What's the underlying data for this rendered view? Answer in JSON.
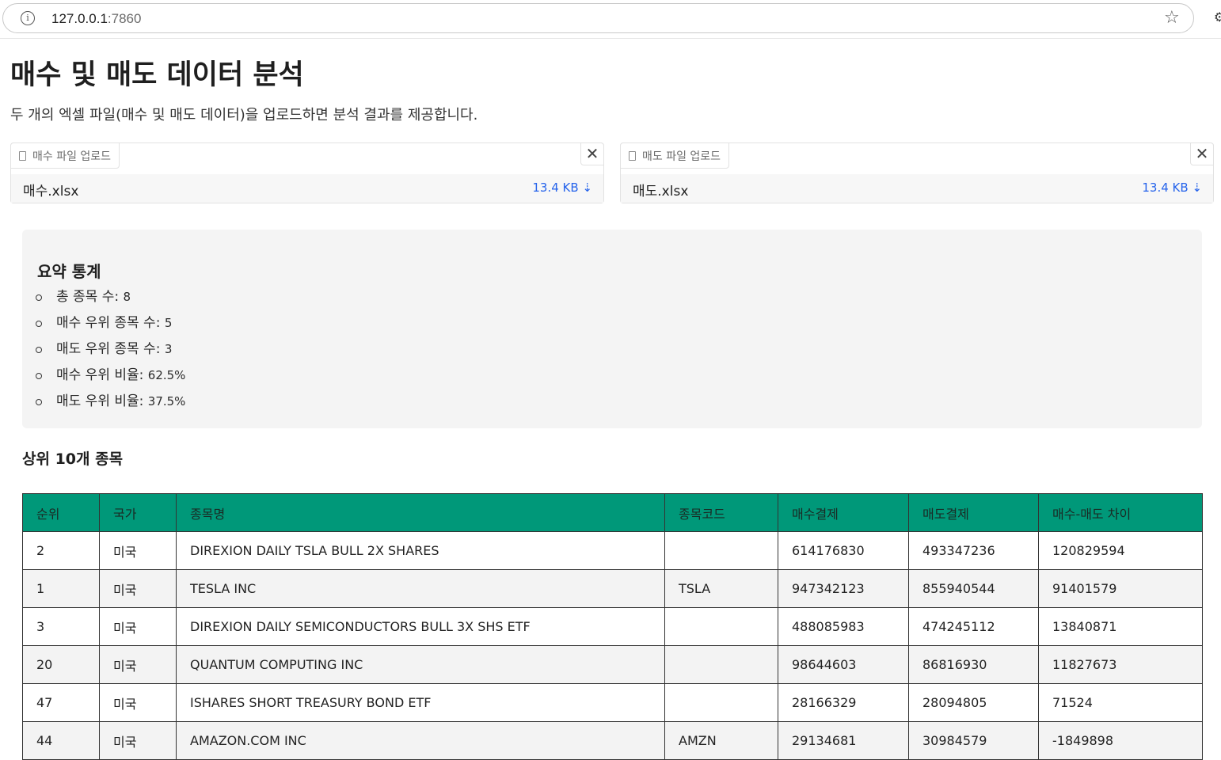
{
  "browser": {
    "url_host": "127.0.0.1",
    "url_port": ":7860"
  },
  "page": {
    "title": "매수 및 매도 데이터 분석",
    "description": "두 개의 엑셀 파일(매수 및 매도 데이터)을 업로드하면 분석 결과를 제공합니다."
  },
  "uploads": [
    {
      "label": "매수 파일 업로드",
      "file_name": "매수.xlsx",
      "file_size": "13.4 KB ⇣"
    },
    {
      "label": "매도 파일 업로드",
      "file_name": "매도.xlsx",
      "file_size": "13.4 KB ⇣"
    }
  ],
  "summary": {
    "title": "요약 통계",
    "items": [
      {
        "label": "총 종목 수:",
        "value": "8"
      },
      {
        "label": "매수 우위 종목 수:",
        "value": "5"
      },
      {
        "label": "매도 우위 종목 수:",
        "value": "3"
      },
      {
        "label": "매수 우위 비율:",
        "value": "62.5%"
      },
      {
        "label": "매도 우위 비율:",
        "value": "37.5%"
      }
    ]
  },
  "table": {
    "title": "상위 10개 종목",
    "header_color": "#009879",
    "columns": [
      "순위",
      "국가",
      "종목명",
      "종목코드",
      "매수결제",
      "매도결제",
      "매수-매도 차이"
    ],
    "rows": [
      [
        "2",
        "미국",
        "DIREXION DAILY TSLA BULL 2X SHARES",
        "",
        "614176830",
        "493347236",
        "120829594"
      ],
      [
        "1",
        "미국",
        "TESLA INC",
        "TSLA",
        "947342123",
        "855940544",
        "91401579"
      ],
      [
        "3",
        "미국",
        "DIREXION DAILY SEMICONDUCTORS BULL 3X SHS ETF",
        "",
        "488085983",
        "474245112",
        "13840871"
      ],
      [
        "20",
        "미국",
        "QUANTUM COMPUTING INC",
        "",
        "98644603",
        "86816930",
        "11827673"
      ],
      [
        "47",
        "미국",
        "ISHARES SHORT TREASURY BOND ETF",
        "",
        "28166329",
        "28094805",
        "71524"
      ],
      [
        "44",
        "미국",
        "AMAZON.COM INC",
        "AMZN",
        "29134681",
        "30984579",
        "-1849898"
      ]
    ]
  }
}
